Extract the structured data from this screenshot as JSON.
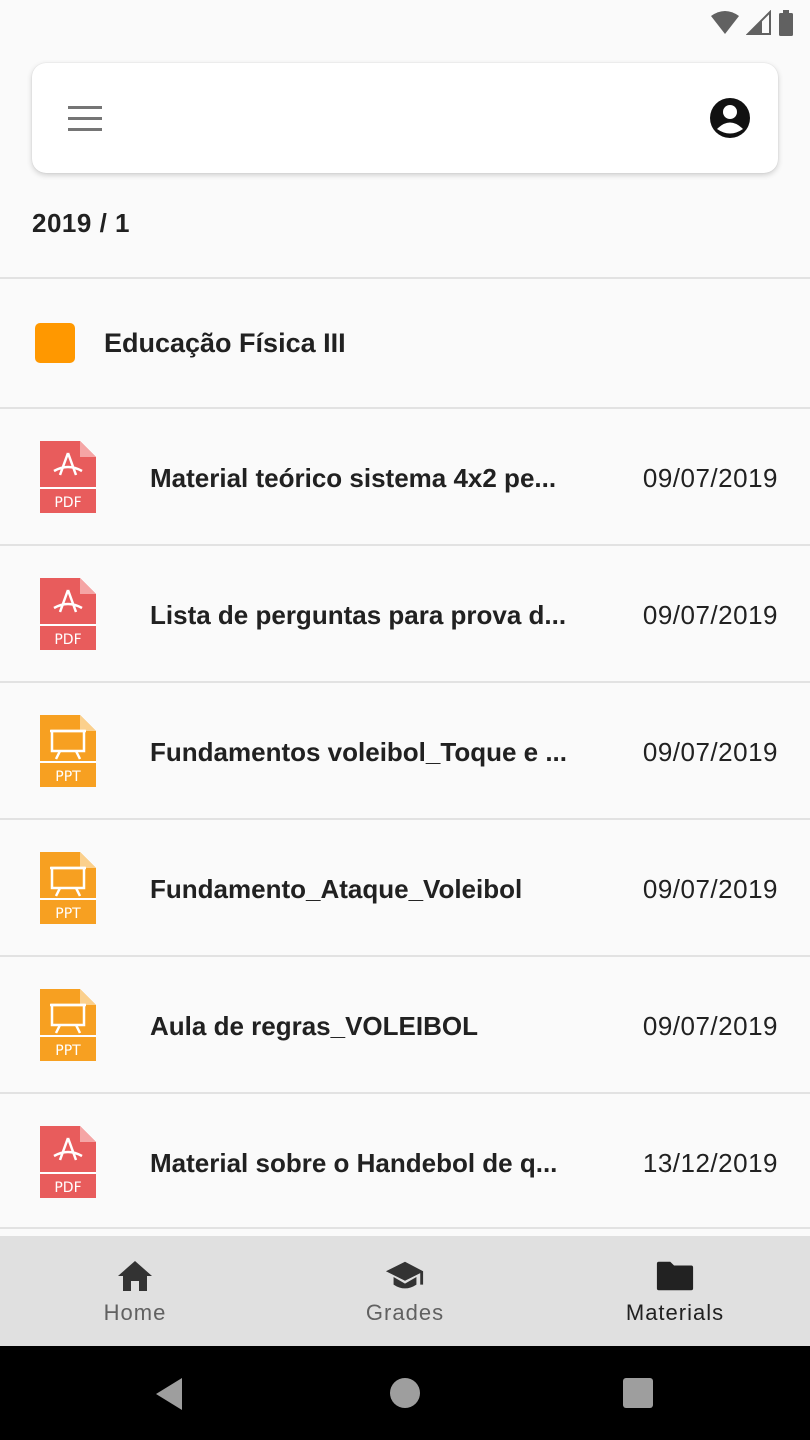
{
  "term_label": "2019 / 1",
  "course": {
    "title": "Educação Física III",
    "color": "#ff9800"
  },
  "files": [
    {
      "type": "PDF",
      "name": "Material teórico sistema 4x2 pe...",
      "date": "09/07/2019"
    },
    {
      "type": "PDF",
      "name": "Lista de perguntas para prova d...",
      "date": "09/07/2019"
    },
    {
      "type": "PPT",
      "name": "Fundamentos voleibol_Toque e ...",
      "date": "09/07/2019"
    },
    {
      "type": "PPT",
      "name": "Fundamento_Ataque_Voleibol",
      "date": "09/07/2019"
    },
    {
      "type": "PPT",
      "name": "Aula de regras_VOLEIBOL",
      "date": "09/07/2019"
    },
    {
      "type": "PDF",
      "name": "Material sobre o Handebol de q...",
      "date": "13/12/2019"
    }
  ],
  "nav": {
    "home_label": "Home",
    "grades_label": "Grades",
    "materials_label": "Materials",
    "active": "Materials"
  },
  "colors": {
    "pdf": "#e85c5c",
    "ppt": "#f7a021",
    "accent": "#ff9800"
  },
  "icons": [
    "wifi-icon",
    "signal-icon",
    "battery-icon",
    "menu-icon",
    "account-icon",
    "pdf-file-icon",
    "ppt-file-icon",
    "home-icon",
    "grades-icon",
    "folder-icon",
    "back-icon",
    "home-circle-icon",
    "recents-icon"
  ]
}
